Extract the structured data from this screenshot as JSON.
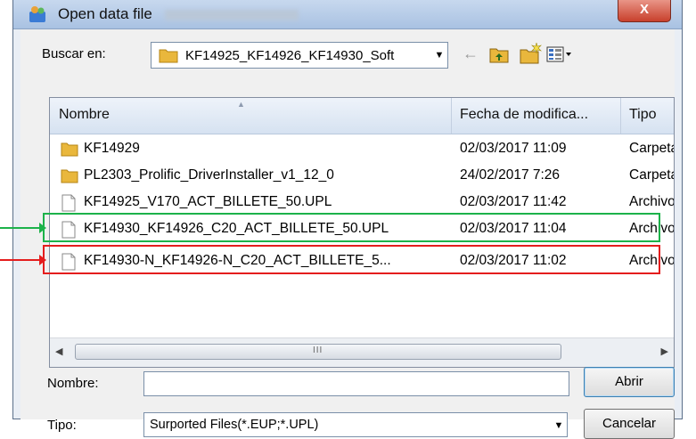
{
  "window": {
    "title": "Open data file",
    "close_label": "X"
  },
  "toolbar": {
    "lookin_label": "Buscar en:",
    "lookin_value": "KF14925_KF14926_KF14930_Soft",
    "back_label": "←"
  },
  "list": {
    "columns": {
      "name": "Nombre",
      "date": "Fecha de modifica...",
      "type": "Tipo"
    },
    "rows": [
      {
        "icon": "folder-icon",
        "name": "KF14929",
        "date": "02/03/2017 11:09",
        "type": "Carpeta"
      },
      {
        "icon": "folder-icon",
        "name": "PL2303_Prolific_DriverInstaller_v1_12_0",
        "date": "24/02/2017 7:26",
        "type": "Carpeta"
      },
      {
        "icon": "file-icon",
        "name": "KF14925_V170_ACT_BILLETE_50.UPL",
        "date": "02/03/2017 11:42",
        "type": "Archivo"
      },
      {
        "icon": "file-icon",
        "name": "KF14930_KF14926_C20_ACT_BILLETE_50.UPL",
        "date": "02/03/2017 11:04",
        "type": "Archivo"
      },
      {
        "icon": "file-icon",
        "name": "KF14930-N_KF14926-N_C20_ACT_BILLETE_5...",
        "date": "02/03/2017 11:02",
        "type": "Archivo"
      }
    ],
    "scroll_grip": "III"
  },
  "form": {
    "name_label": "Nombre:",
    "name_value": "",
    "type_label": "Tipo:",
    "type_value": "Surported Files(*.EUP;*.UPL)",
    "open_label": "Abrir",
    "cancel_label": "Cancelar"
  },
  "colors": {
    "highlight_green": "#1cb24a",
    "highlight_red": "#e41d1d"
  }
}
